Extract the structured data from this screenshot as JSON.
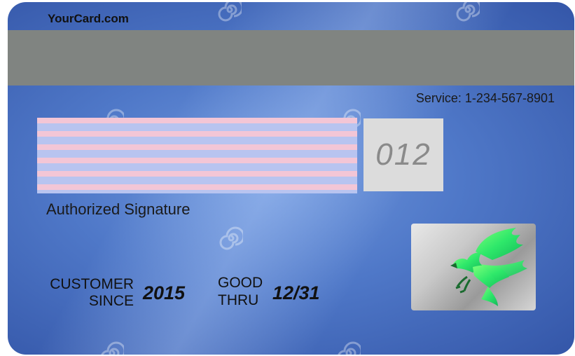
{
  "card": {
    "brand": "YourCard.com",
    "service": "Service: 1-234-567-8901",
    "cvv": "012",
    "signature_label": "Authorized Signature",
    "customer_since_label_line1": "CUSTOMER",
    "customer_since_label_line2": "SINCE",
    "customer_since_value": "2015",
    "good_thru_label_line1": "GOOD",
    "good_thru_label_line2": "THRU",
    "good_thru_value": "12/31"
  },
  "icons": {
    "hologram": "eagle-icon",
    "watermark": "spiral-watermark-icon"
  },
  "colors": {
    "card_base": "#4f78c8",
    "magnetic_stripe": "#808481",
    "signature_pink": "#f3c6d6",
    "signature_blue": "#b8c4f0",
    "hologram_green": "#2ee86a"
  }
}
